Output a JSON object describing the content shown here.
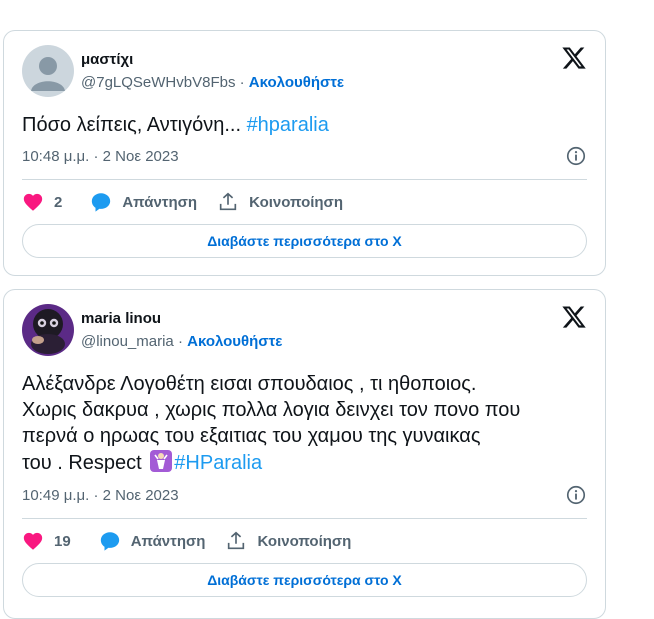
{
  "tweets": [
    {
      "display_name": "μαστίχι",
      "handle": "@7gLQSeWHvbV8Fbs",
      "separator": "·",
      "follow_label": "Ακολουθήστε",
      "text": "Πόσο λείπεις, Αντιγόνη...",
      "hashtag": "#hparalia",
      "timestamp": "10:48 μ.μ. · 2 Νοε 2023",
      "like_count": "2",
      "reply_label": "Απάντηση",
      "share_label": "Κοινοποίηση",
      "read_more_label": "Διαβάστε περισσότερα στο X",
      "avatar_icon": "default-avatar-icon"
    },
    {
      "display_name": "maria linou",
      "handle": "@linou_maria",
      "separator": "·",
      "follow_label": "Ακολουθήστε",
      "text_lines": [
        "Αλέξανδρε Λογοθέτη εισαι σπουδαιος , τι ηθοποιος.",
        "Χωρις δακρυα , χωρις πολλα λογια δεινχει τον πονο που",
        "περνά ο ηρωας του εξαιτιας του χαμου της γυναικας",
        "του . Respect"
      ],
      "hashtag": "#HParalia",
      "timestamp": "10:49 μ.μ. · 2 Νοε 2023",
      "like_count": "19",
      "reply_label": "Απάντηση",
      "share_label": "Κοινοποίηση",
      "read_more_label": "Διαβάστε περισσότερα στο X",
      "avatar_icon": "profile-photo-avatar",
      "emoji_icon": "person-bowing-emoji"
    }
  ],
  "colors": {
    "like_pink": "#f91880",
    "reply_blue": "#1d9bf0",
    "link_blue": "#006fd6",
    "hashtag_blue": "#1d9bf0",
    "muted_gray": "#536471",
    "border": "#cfd9de"
  }
}
